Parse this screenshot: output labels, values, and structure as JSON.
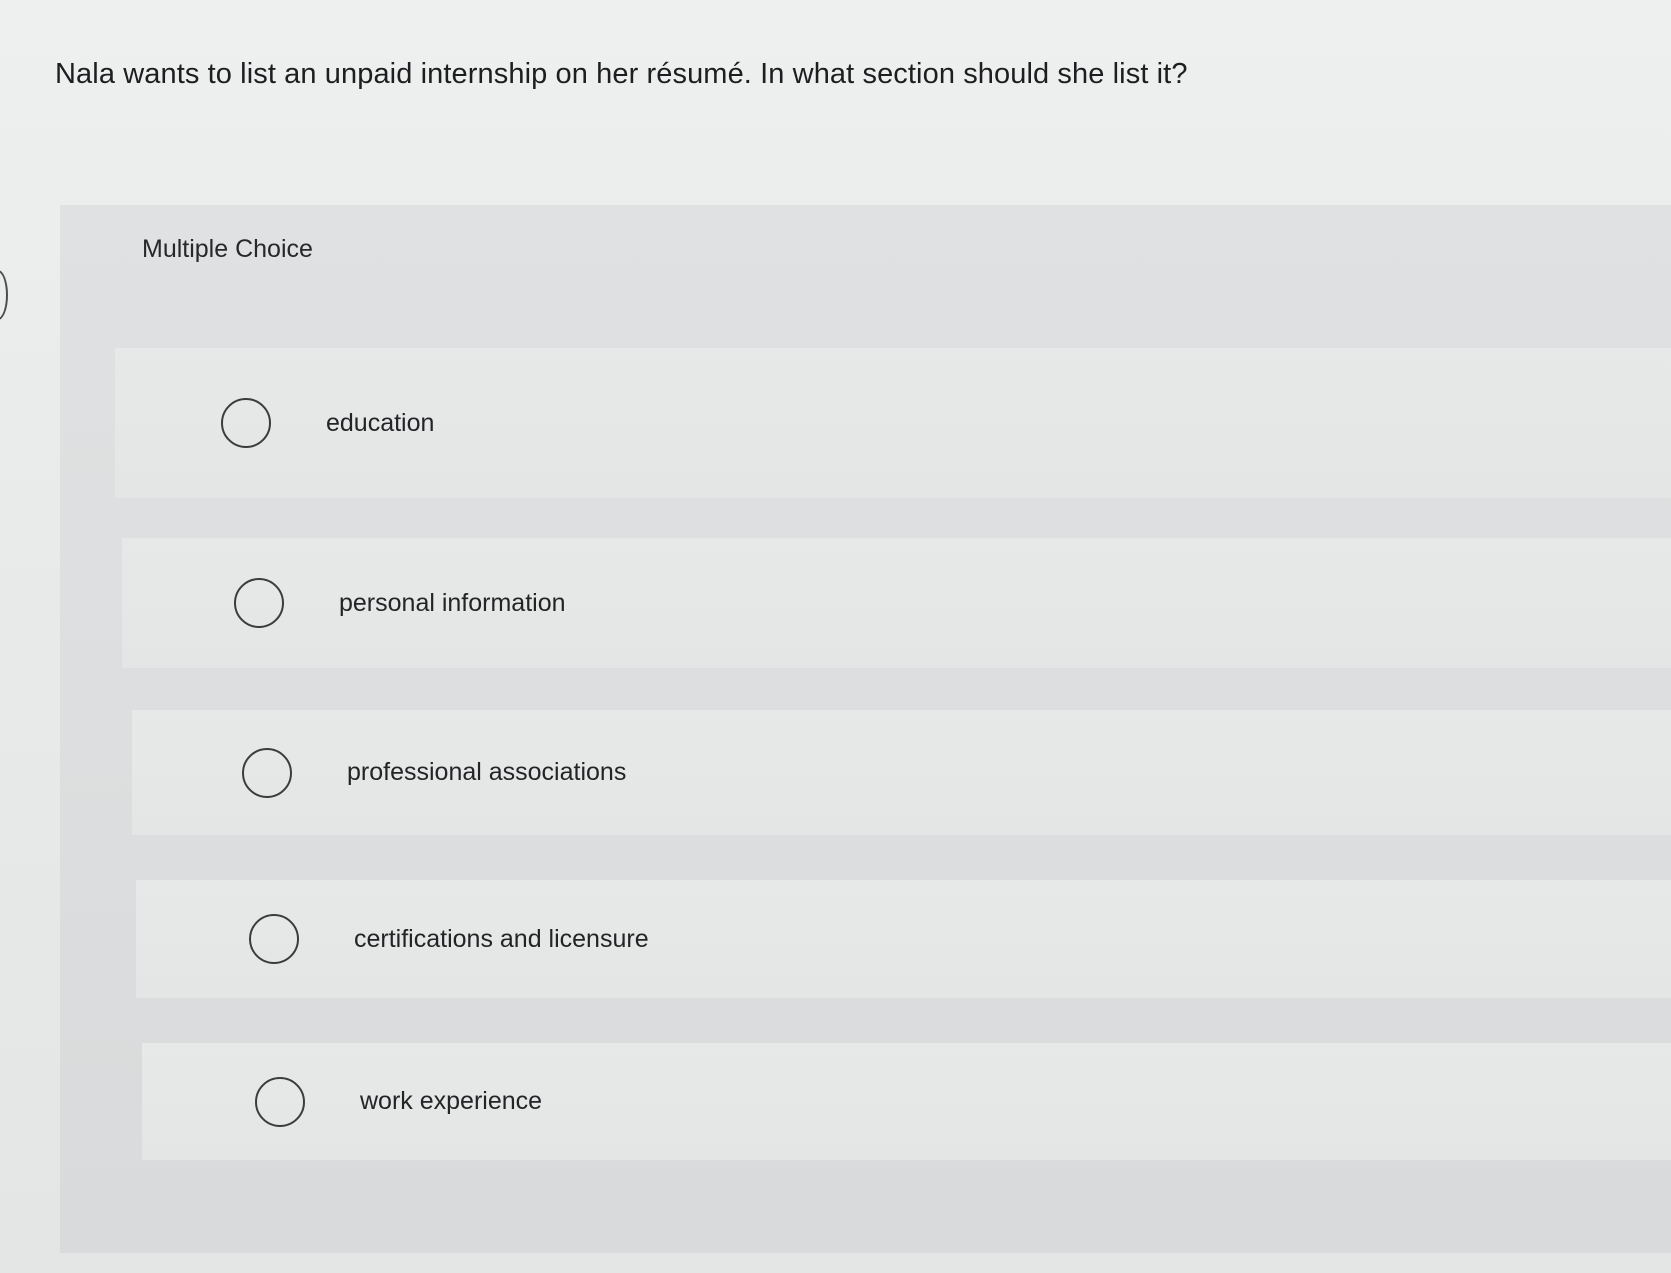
{
  "question": {
    "text": "Nala wants to list an unpaid internship on her résumé. In what section should she list it?"
  },
  "multiple_choice": {
    "label": "Multiple Choice",
    "options": [
      {
        "label": "education",
        "selected": false
      },
      {
        "label": "personal information",
        "selected": false
      },
      {
        "label": "professional associations",
        "selected": false
      },
      {
        "label": "certifications and licensure",
        "selected": false
      },
      {
        "label": "work experience",
        "selected": false
      }
    ]
  },
  "colors": {
    "page_background": "#eceeee",
    "panel_background": "#dcdedf",
    "option_background": "#e6e8e8",
    "radio_border": "#3a3c3e",
    "text": "#1d1f21"
  }
}
